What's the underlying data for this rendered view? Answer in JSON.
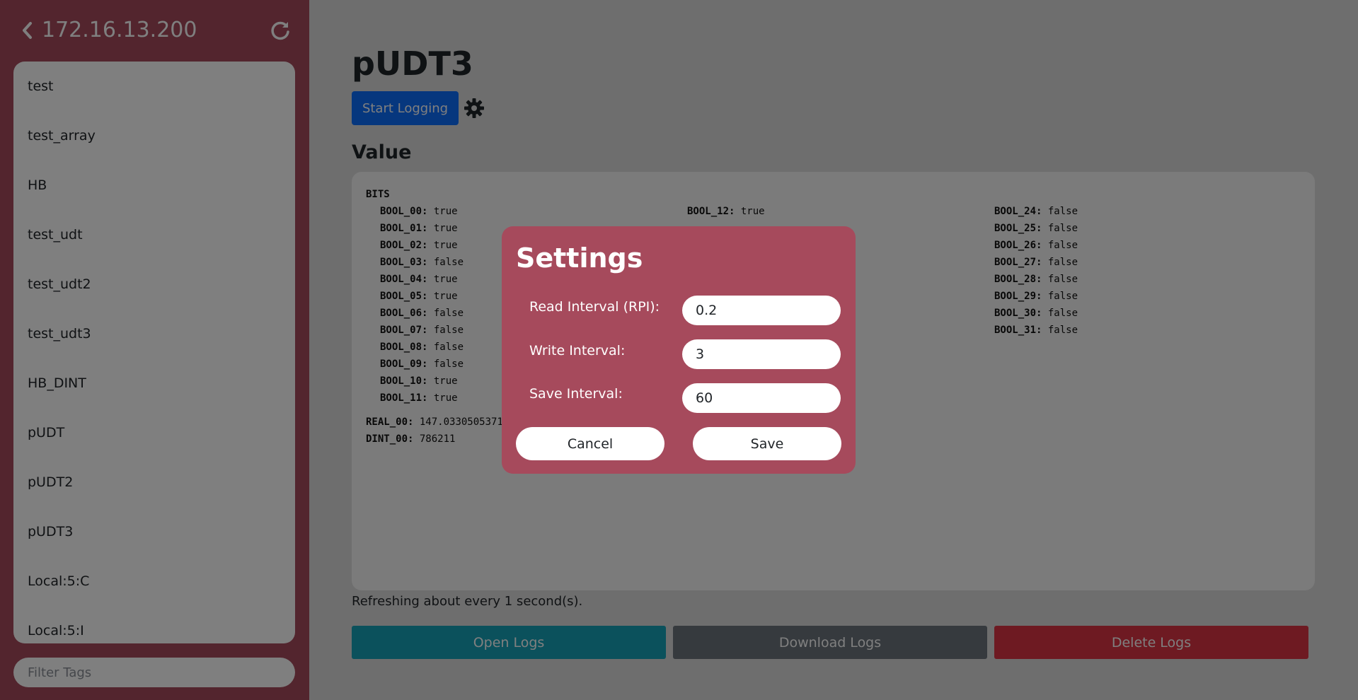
{
  "sidebar": {
    "host": "172.16.13.200",
    "back_icon": "chevron-left-icon",
    "refresh_icon": "refresh-icon",
    "items": [
      {
        "label": "test"
      },
      {
        "label": "test_array"
      },
      {
        "label": "HB"
      },
      {
        "label": "test_udt"
      },
      {
        "label": "test_udt2"
      },
      {
        "label": "test_udt3"
      },
      {
        "label": "HB_DINT"
      },
      {
        "label": "pUDT"
      },
      {
        "label": "pUDT2"
      },
      {
        "label": "pUDT3"
      },
      {
        "label": "Local:5:C"
      },
      {
        "label": "Local:5:I"
      }
    ],
    "filter_placeholder": "Filter Tags",
    "color": "#a64a5c"
  },
  "main": {
    "title": "pUDT3",
    "start_logging_label": "Start Logging",
    "settings_icon": "gear-icon",
    "value_heading": "Value",
    "bits_label": "BITS",
    "bools_col1": [
      {
        "name": "BOOL_00:",
        "value": "true"
      },
      {
        "name": "BOOL_01:",
        "value": "true"
      },
      {
        "name": "BOOL_02:",
        "value": "true"
      },
      {
        "name": "BOOL_03:",
        "value": "false"
      },
      {
        "name": "BOOL_04:",
        "value": "true"
      },
      {
        "name": "BOOL_05:",
        "value": "true"
      },
      {
        "name": "BOOL_06:",
        "value": "false"
      },
      {
        "name": "BOOL_07:",
        "value": "false"
      },
      {
        "name": "BOOL_08:",
        "value": "false"
      },
      {
        "name": "BOOL_09:",
        "value": "false"
      },
      {
        "name": "BOOL_10:",
        "value": "true"
      },
      {
        "name": "BOOL_11:",
        "value": "true"
      }
    ],
    "bools_col2": [
      {
        "name": "BOOL_12:",
        "value": "true"
      }
    ],
    "bools_col3": [
      {
        "name": "BOOL_24:",
        "value": "false"
      },
      {
        "name": "BOOL_25:",
        "value": "false"
      },
      {
        "name": "BOOL_26:",
        "value": "false"
      },
      {
        "name": "BOOL_27:",
        "value": "false"
      },
      {
        "name": "BOOL_28:",
        "value": "false"
      },
      {
        "name": "BOOL_29:",
        "value": "false"
      },
      {
        "name": "BOOL_30:",
        "value": "false"
      },
      {
        "name": "BOOL_31:",
        "value": "false"
      }
    ],
    "real": {
      "name": "REAL_00:",
      "value": "147.0330505371"
    },
    "dint": {
      "name": "DINT_00:",
      "value": "786211"
    },
    "refresh_note": "Refreshing about every 1 second(s).",
    "buttons": {
      "open_logs": "Open Logs",
      "download_logs": "Download Logs",
      "delete_logs": "Delete Logs"
    },
    "colors": {
      "primary": "#0d6efd",
      "open_logs": "#17a2b8",
      "download_logs": "#6c757d",
      "delete_logs": "#dc3545"
    }
  },
  "modal": {
    "title": "Settings",
    "fields": [
      {
        "label": "Read Interval (RPI):",
        "value": "0.2"
      },
      {
        "label": "Write Interval:",
        "value": "3"
      },
      {
        "label": "Save Interval:",
        "value": "60"
      }
    ],
    "cancel_label": "Cancel",
    "save_label": "Save"
  }
}
